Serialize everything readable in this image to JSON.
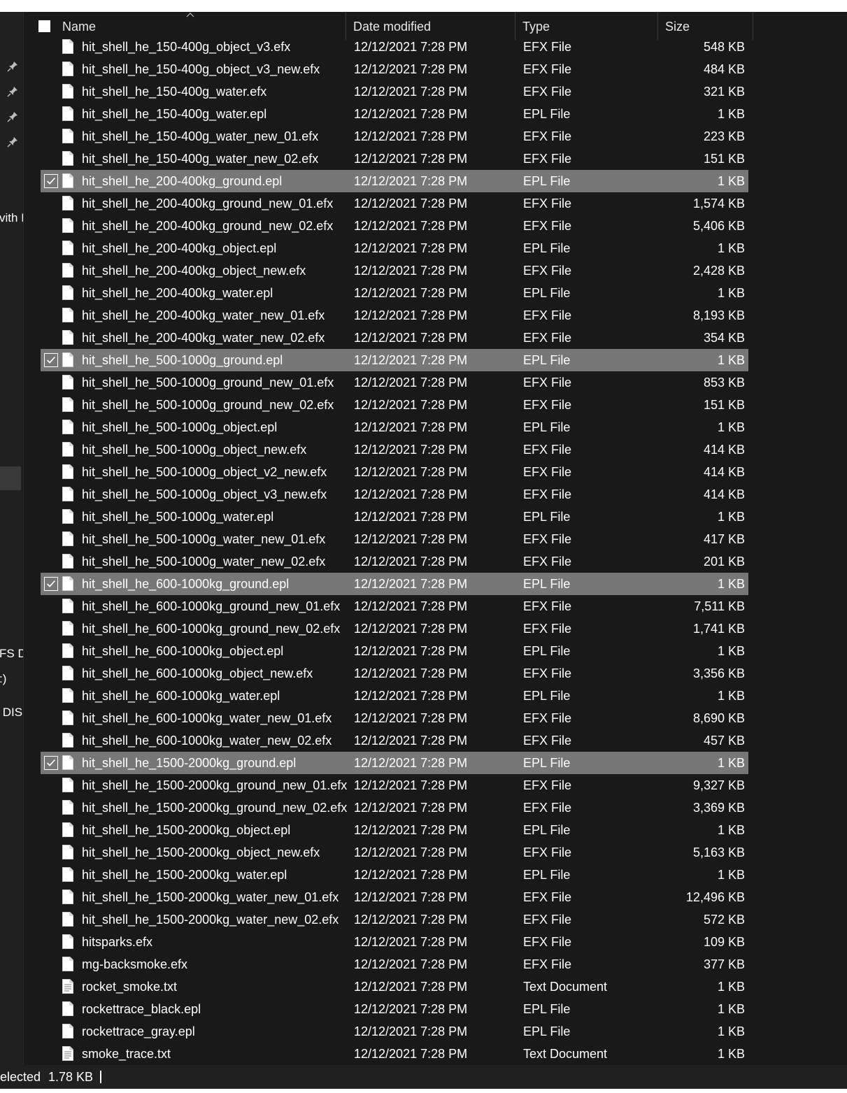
{
  "sidebar": {
    "pins": [
      "pin-icon",
      "pin-icon",
      "pin-icon",
      "pin-icon"
    ],
    "texts": [
      "vith I",
      "FS D",
      ":)",
      " DIS"
    ]
  },
  "columns": {
    "name": "Name",
    "date": "Date modified",
    "type": "Type",
    "size": "Size"
  },
  "files": [
    {
      "name": "hit_shell_he_150-400g_object_v3.efx",
      "date": "12/12/2021 7:28 PM",
      "type": "EFX File",
      "size": "548 KB",
      "selected": false,
      "icon": "file-icon"
    },
    {
      "name": "hit_shell_he_150-400g_object_v3_new.efx",
      "date": "12/12/2021 7:28 PM",
      "type": "EFX File",
      "size": "484 KB",
      "selected": false,
      "icon": "file-icon"
    },
    {
      "name": "hit_shell_he_150-400g_water.efx",
      "date": "12/12/2021 7:28 PM",
      "type": "EFX File",
      "size": "321 KB",
      "selected": false,
      "icon": "file-icon"
    },
    {
      "name": "hit_shell_he_150-400g_water.epl",
      "date": "12/12/2021 7:28 PM",
      "type": "EPL File",
      "size": "1 KB",
      "selected": false,
      "icon": "file-icon"
    },
    {
      "name": "hit_shell_he_150-400g_water_new_01.efx",
      "date": "12/12/2021 7:28 PM",
      "type": "EFX File",
      "size": "223 KB",
      "selected": false,
      "icon": "file-icon"
    },
    {
      "name": "hit_shell_he_150-400g_water_new_02.efx",
      "date": "12/12/2021 7:28 PM",
      "type": "EFX File",
      "size": "151 KB",
      "selected": false,
      "icon": "file-icon"
    },
    {
      "name": "hit_shell_he_200-400kg_ground.epl",
      "date": "12/12/2021 7:28 PM",
      "type": "EPL File",
      "size": "1 KB",
      "selected": true,
      "icon": "file-icon"
    },
    {
      "name": "hit_shell_he_200-400kg_ground_new_01.efx",
      "date": "12/12/2021 7:28 PM",
      "type": "EFX File",
      "size": "1,574 KB",
      "selected": false,
      "icon": "file-icon"
    },
    {
      "name": "hit_shell_he_200-400kg_ground_new_02.efx",
      "date": "12/12/2021 7:28 PM",
      "type": "EFX File",
      "size": "5,406 KB",
      "selected": false,
      "icon": "file-icon"
    },
    {
      "name": "hit_shell_he_200-400kg_object.epl",
      "date": "12/12/2021 7:28 PM",
      "type": "EPL File",
      "size": "1 KB",
      "selected": false,
      "icon": "file-icon"
    },
    {
      "name": "hit_shell_he_200-400kg_object_new.efx",
      "date": "12/12/2021 7:28 PM",
      "type": "EFX File",
      "size": "2,428 KB",
      "selected": false,
      "icon": "file-icon"
    },
    {
      "name": "hit_shell_he_200-400kg_water.epl",
      "date": "12/12/2021 7:28 PM",
      "type": "EPL File",
      "size": "1 KB",
      "selected": false,
      "icon": "file-icon"
    },
    {
      "name": "hit_shell_he_200-400kg_water_new_01.efx",
      "date": "12/12/2021 7:28 PM",
      "type": "EFX File",
      "size": "8,193 KB",
      "selected": false,
      "icon": "file-icon"
    },
    {
      "name": "hit_shell_he_200-400kg_water_new_02.efx",
      "date": "12/12/2021 7:28 PM",
      "type": "EFX File",
      "size": "354 KB",
      "selected": false,
      "icon": "file-icon"
    },
    {
      "name": "hit_shell_he_500-1000g_ground.epl",
      "date": "12/12/2021 7:28 PM",
      "type": "EPL File",
      "size": "1 KB",
      "selected": true,
      "icon": "file-icon"
    },
    {
      "name": "hit_shell_he_500-1000g_ground_new_01.efx",
      "date": "12/12/2021 7:28 PM",
      "type": "EFX File",
      "size": "853 KB",
      "selected": false,
      "icon": "file-icon"
    },
    {
      "name": "hit_shell_he_500-1000g_ground_new_02.efx",
      "date": "12/12/2021 7:28 PM",
      "type": "EFX File",
      "size": "151 KB",
      "selected": false,
      "icon": "file-icon"
    },
    {
      "name": "hit_shell_he_500-1000g_object.epl",
      "date": "12/12/2021 7:28 PM",
      "type": "EPL File",
      "size": "1 KB",
      "selected": false,
      "icon": "file-icon"
    },
    {
      "name": "hit_shell_he_500-1000g_object_new.efx",
      "date": "12/12/2021 7:28 PM",
      "type": "EFX File",
      "size": "414 KB",
      "selected": false,
      "icon": "file-icon"
    },
    {
      "name": "hit_shell_he_500-1000g_object_v2_new.efx",
      "date": "12/12/2021 7:28 PM",
      "type": "EFX File",
      "size": "414 KB",
      "selected": false,
      "icon": "file-icon"
    },
    {
      "name": "hit_shell_he_500-1000g_object_v3_new.efx",
      "date": "12/12/2021 7:28 PM",
      "type": "EFX File",
      "size": "414 KB",
      "selected": false,
      "icon": "file-icon"
    },
    {
      "name": "hit_shell_he_500-1000g_water.epl",
      "date": "12/12/2021 7:28 PM",
      "type": "EPL File",
      "size": "1 KB",
      "selected": false,
      "icon": "file-icon"
    },
    {
      "name": "hit_shell_he_500-1000g_water_new_01.efx",
      "date": "12/12/2021 7:28 PM",
      "type": "EFX File",
      "size": "417 KB",
      "selected": false,
      "icon": "file-icon"
    },
    {
      "name": "hit_shell_he_500-1000g_water_new_02.efx",
      "date": "12/12/2021 7:28 PM",
      "type": "EFX File",
      "size": "201 KB",
      "selected": false,
      "icon": "file-icon"
    },
    {
      "name": "hit_shell_he_600-1000kg_ground.epl",
      "date": "12/12/2021 7:28 PM",
      "type": "EPL File",
      "size": "1 KB",
      "selected": true,
      "icon": "file-icon"
    },
    {
      "name": "hit_shell_he_600-1000kg_ground_new_01.efx",
      "date": "12/12/2021 7:28 PM",
      "type": "EFX File",
      "size": "7,511 KB",
      "selected": false,
      "icon": "file-icon"
    },
    {
      "name": "hit_shell_he_600-1000kg_ground_new_02.efx",
      "date": "12/12/2021 7:28 PM",
      "type": "EFX File",
      "size": "1,741 KB",
      "selected": false,
      "icon": "file-icon"
    },
    {
      "name": "hit_shell_he_600-1000kg_object.epl",
      "date": "12/12/2021 7:28 PM",
      "type": "EPL File",
      "size": "1 KB",
      "selected": false,
      "icon": "file-icon"
    },
    {
      "name": "hit_shell_he_600-1000kg_object_new.efx",
      "date": "12/12/2021 7:28 PM",
      "type": "EFX File",
      "size": "3,356 KB",
      "selected": false,
      "icon": "file-icon"
    },
    {
      "name": "hit_shell_he_600-1000kg_water.epl",
      "date": "12/12/2021 7:28 PM",
      "type": "EPL File",
      "size": "1 KB",
      "selected": false,
      "icon": "file-icon"
    },
    {
      "name": "hit_shell_he_600-1000kg_water_new_01.efx",
      "date": "12/12/2021 7:28 PM",
      "type": "EFX File",
      "size": "8,690 KB",
      "selected": false,
      "icon": "file-icon"
    },
    {
      "name": "hit_shell_he_600-1000kg_water_new_02.efx",
      "date": "12/12/2021 7:28 PM",
      "type": "EFX File",
      "size": "457 KB",
      "selected": false,
      "icon": "file-icon"
    },
    {
      "name": "hit_shell_he_1500-2000kg_ground.epl",
      "date": "12/12/2021 7:28 PM",
      "type": "EPL File",
      "size": "1 KB",
      "selected": true,
      "icon": "file-icon"
    },
    {
      "name": "hit_shell_he_1500-2000kg_ground_new_01.efx",
      "date": "12/12/2021 7:28 PM",
      "type": "EFX File",
      "size": "9,327 KB",
      "selected": false,
      "icon": "file-icon"
    },
    {
      "name": "hit_shell_he_1500-2000kg_ground_new_02.efx",
      "date": "12/12/2021 7:28 PM",
      "type": "EFX File",
      "size": "3,369 KB",
      "selected": false,
      "icon": "file-icon"
    },
    {
      "name": "hit_shell_he_1500-2000kg_object.epl",
      "date": "12/12/2021 7:28 PM",
      "type": "EPL File",
      "size": "1 KB",
      "selected": false,
      "icon": "file-icon"
    },
    {
      "name": "hit_shell_he_1500-2000kg_object_new.efx",
      "date": "12/12/2021 7:28 PM",
      "type": "EFX File",
      "size": "5,163 KB",
      "selected": false,
      "icon": "file-icon"
    },
    {
      "name": "hit_shell_he_1500-2000kg_water.epl",
      "date": "12/12/2021 7:28 PM",
      "type": "EPL File",
      "size": "1 KB",
      "selected": false,
      "icon": "file-icon"
    },
    {
      "name": "hit_shell_he_1500-2000kg_water_new_01.efx",
      "date": "12/12/2021 7:28 PM",
      "type": "EFX File",
      "size": "12,496 KB",
      "selected": false,
      "icon": "file-icon"
    },
    {
      "name": "hit_shell_he_1500-2000kg_water_new_02.efx",
      "date": "12/12/2021 7:28 PM",
      "type": "EFX File",
      "size": "572 KB",
      "selected": false,
      "icon": "file-icon"
    },
    {
      "name": "hitsparks.efx",
      "date": "12/12/2021 7:28 PM",
      "type": "EFX File",
      "size": "109 KB",
      "selected": false,
      "icon": "file-icon"
    },
    {
      "name": "mg-backsmoke.efx",
      "date": "12/12/2021 7:28 PM",
      "type": "EFX File",
      "size": "377 KB",
      "selected": false,
      "icon": "file-icon"
    },
    {
      "name": "rocket_smoke.txt",
      "date": "12/12/2021 7:28 PM",
      "type": "Text Document",
      "size": "1 KB",
      "selected": false,
      "icon": "text-file-icon"
    },
    {
      "name": "rockettrace_black.epl",
      "date": "12/12/2021 7:28 PM",
      "type": "EPL File",
      "size": "1 KB",
      "selected": false,
      "icon": "file-icon"
    },
    {
      "name": "rockettrace_gray.epl",
      "date": "12/12/2021 7:28 PM",
      "type": "EPL File",
      "size": "1 KB",
      "selected": false,
      "icon": "file-icon"
    },
    {
      "name": "smoke_trace.txt",
      "date": "12/12/2021 7:28 PM",
      "type": "Text Document",
      "size": "1 KB",
      "selected": false,
      "icon": "text-file-icon"
    }
  ],
  "status": {
    "selection_text": "elected",
    "selection_size": "1.78 KB"
  },
  "colors": {
    "background": "#191919",
    "selected_row": "#777777",
    "text": "#ffffff"
  }
}
